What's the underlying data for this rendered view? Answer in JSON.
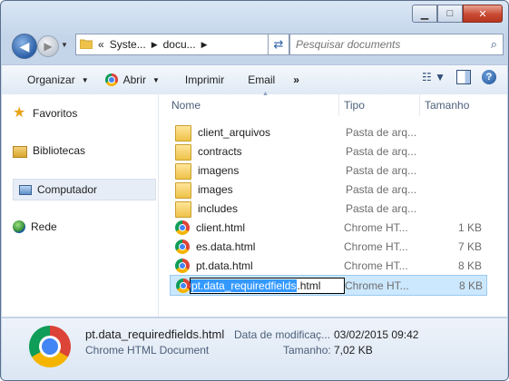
{
  "window": {
    "controls": {
      "minimize": "▁",
      "maximize": "□",
      "close": "✕"
    }
  },
  "address": {
    "prefix": "«",
    "crumbs": [
      "Syste...",
      "docu..."
    ],
    "search_placeholder": "Pesquisar documents"
  },
  "toolbar": {
    "organize": "Organizar",
    "open": "Abrir",
    "print": "Imprimir",
    "email": "Email",
    "more": "»"
  },
  "sidebar": {
    "items": [
      {
        "label": "Favoritos",
        "icon": "star-icon"
      },
      {
        "label": "Bibliotecas",
        "icon": "library-icon"
      },
      {
        "label": "Computador",
        "icon": "computer-icon",
        "selected": true
      },
      {
        "label": "Rede",
        "icon": "network-icon"
      }
    ]
  },
  "columns": {
    "name": "Nome",
    "type": "Tipo",
    "size": "Tamanho"
  },
  "files": [
    {
      "name": "client_arquivos",
      "type": "Pasta de arq...",
      "size": "",
      "icon": "folder-icon"
    },
    {
      "name": "contracts",
      "type": "Pasta de arq...",
      "size": "",
      "icon": "folder-icon"
    },
    {
      "name": "imagens",
      "type": "Pasta de arq...",
      "size": "",
      "icon": "folder-icon"
    },
    {
      "name": "images",
      "type": "Pasta de arq...",
      "size": "",
      "icon": "folder-icon"
    },
    {
      "name": "includes",
      "type": "Pasta de arq...",
      "size": "",
      "icon": "folder-icon"
    },
    {
      "name": "client.html",
      "type": "Chrome HT...",
      "size": "1 KB",
      "icon": "chrome-icon"
    },
    {
      "name": "es.data.html",
      "type": "Chrome HT...",
      "size": "7 KB",
      "icon": "chrome-icon"
    },
    {
      "name": "pt.data.html",
      "type": "Chrome HT...",
      "size": "8 KB",
      "icon": "chrome-icon"
    }
  ],
  "selected_file": {
    "name_selected_part": "pt.data_requiredfields",
    "name_ext": ".html",
    "type": "Chrome HT...",
    "size": "8 KB"
  },
  "details": {
    "filename": "pt.data_requiredfields.html",
    "type": "Chrome HTML Document",
    "modified_label": "Data de modificaç...",
    "modified_value": "03/02/2015 09:42",
    "size_label": "Tamanho:",
    "size_value": "7,02 KB"
  }
}
